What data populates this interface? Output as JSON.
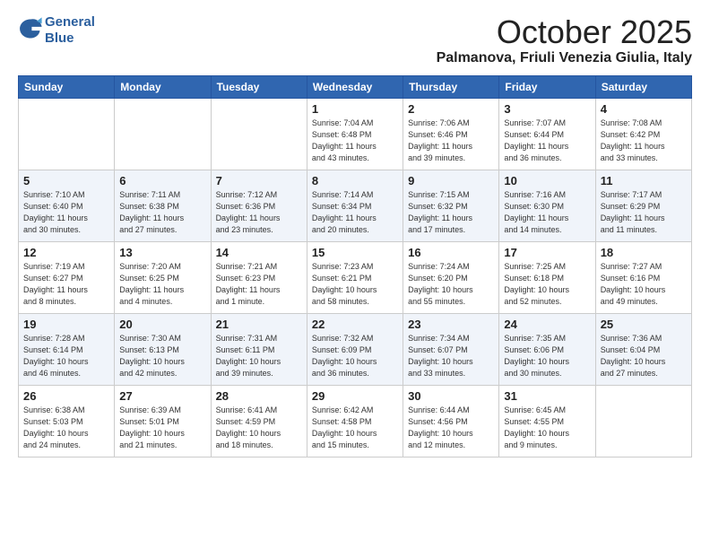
{
  "header": {
    "logo_line1": "General",
    "logo_line2": "Blue",
    "month": "October 2025",
    "location": "Palmanova, Friuli Venezia Giulia, Italy"
  },
  "weekdays": [
    "Sunday",
    "Monday",
    "Tuesday",
    "Wednesday",
    "Thursday",
    "Friday",
    "Saturday"
  ],
  "weeks": [
    [
      {
        "day": "",
        "info": ""
      },
      {
        "day": "",
        "info": ""
      },
      {
        "day": "",
        "info": ""
      },
      {
        "day": "1",
        "info": "Sunrise: 7:04 AM\nSunset: 6:48 PM\nDaylight: 11 hours\nand 43 minutes."
      },
      {
        "day": "2",
        "info": "Sunrise: 7:06 AM\nSunset: 6:46 PM\nDaylight: 11 hours\nand 39 minutes."
      },
      {
        "day": "3",
        "info": "Sunrise: 7:07 AM\nSunset: 6:44 PM\nDaylight: 11 hours\nand 36 minutes."
      },
      {
        "day": "4",
        "info": "Sunrise: 7:08 AM\nSunset: 6:42 PM\nDaylight: 11 hours\nand 33 minutes."
      }
    ],
    [
      {
        "day": "5",
        "info": "Sunrise: 7:10 AM\nSunset: 6:40 PM\nDaylight: 11 hours\nand 30 minutes."
      },
      {
        "day": "6",
        "info": "Sunrise: 7:11 AM\nSunset: 6:38 PM\nDaylight: 11 hours\nand 27 minutes."
      },
      {
        "day": "7",
        "info": "Sunrise: 7:12 AM\nSunset: 6:36 PM\nDaylight: 11 hours\nand 23 minutes."
      },
      {
        "day": "8",
        "info": "Sunrise: 7:14 AM\nSunset: 6:34 PM\nDaylight: 11 hours\nand 20 minutes."
      },
      {
        "day": "9",
        "info": "Sunrise: 7:15 AM\nSunset: 6:32 PM\nDaylight: 11 hours\nand 17 minutes."
      },
      {
        "day": "10",
        "info": "Sunrise: 7:16 AM\nSunset: 6:30 PM\nDaylight: 11 hours\nand 14 minutes."
      },
      {
        "day": "11",
        "info": "Sunrise: 7:17 AM\nSunset: 6:29 PM\nDaylight: 11 hours\nand 11 minutes."
      }
    ],
    [
      {
        "day": "12",
        "info": "Sunrise: 7:19 AM\nSunset: 6:27 PM\nDaylight: 11 hours\nand 8 minutes."
      },
      {
        "day": "13",
        "info": "Sunrise: 7:20 AM\nSunset: 6:25 PM\nDaylight: 11 hours\nand 4 minutes."
      },
      {
        "day": "14",
        "info": "Sunrise: 7:21 AM\nSunset: 6:23 PM\nDaylight: 11 hours\nand 1 minute."
      },
      {
        "day": "15",
        "info": "Sunrise: 7:23 AM\nSunset: 6:21 PM\nDaylight: 10 hours\nand 58 minutes."
      },
      {
        "day": "16",
        "info": "Sunrise: 7:24 AM\nSunset: 6:20 PM\nDaylight: 10 hours\nand 55 minutes."
      },
      {
        "day": "17",
        "info": "Sunrise: 7:25 AM\nSunset: 6:18 PM\nDaylight: 10 hours\nand 52 minutes."
      },
      {
        "day": "18",
        "info": "Sunrise: 7:27 AM\nSunset: 6:16 PM\nDaylight: 10 hours\nand 49 minutes."
      }
    ],
    [
      {
        "day": "19",
        "info": "Sunrise: 7:28 AM\nSunset: 6:14 PM\nDaylight: 10 hours\nand 46 minutes."
      },
      {
        "day": "20",
        "info": "Sunrise: 7:30 AM\nSunset: 6:13 PM\nDaylight: 10 hours\nand 42 minutes."
      },
      {
        "day": "21",
        "info": "Sunrise: 7:31 AM\nSunset: 6:11 PM\nDaylight: 10 hours\nand 39 minutes."
      },
      {
        "day": "22",
        "info": "Sunrise: 7:32 AM\nSunset: 6:09 PM\nDaylight: 10 hours\nand 36 minutes."
      },
      {
        "day": "23",
        "info": "Sunrise: 7:34 AM\nSunset: 6:07 PM\nDaylight: 10 hours\nand 33 minutes."
      },
      {
        "day": "24",
        "info": "Sunrise: 7:35 AM\nSunset: 6:06 PM\nDaylight: 10 hours\nand 30 minutes."
      },
      {
        "day": "25",
        "info": "Sunrise: 7:36 AM\nSunset: 6:04 PM\nDaylight: 10 hours\nand 27 minutes."
      }
    ],
    [
      {
        "day": "26",
        "info": "Sunrise: 6:38 AM\nSunset: 5:03 PM\nDaylight: 10 hours\nand 24 minutes."
      },
      {
        "day": "27",
        "info": "Sunrise: 6:39 AM\nSunset: 5:01 PM\nDaylight: 10 hours\nand 21 minutes."
      },
      {
        "day": "28",
        "info": "Sunrise: 6:41 AM\nSunset: 4:59 PM\nDaylight: 10 hours\nand 18 minutes."
      },
      {
        "day": "29",
        "info": "Sunrise: 6:42 AM\nSunset: 4:58 PM\nDaylight: 10 hours\nand 15 minutes."
      },
      {
        "day": "30",
        "info": "Sunrise: 6:44 AM\nSunset: 4:56 PM\nDaylight: 10 hours\nand 12 minutes."
      },
      {
        "day": "31",
        "info": "Sunrise: 6:45 AM\nSunset: 4:55 PM\nDaylight: 10 hours\nand 9 minutes."
      },
      {
        "day": "",
        "info": ""
      }
    ]
  ]
}
